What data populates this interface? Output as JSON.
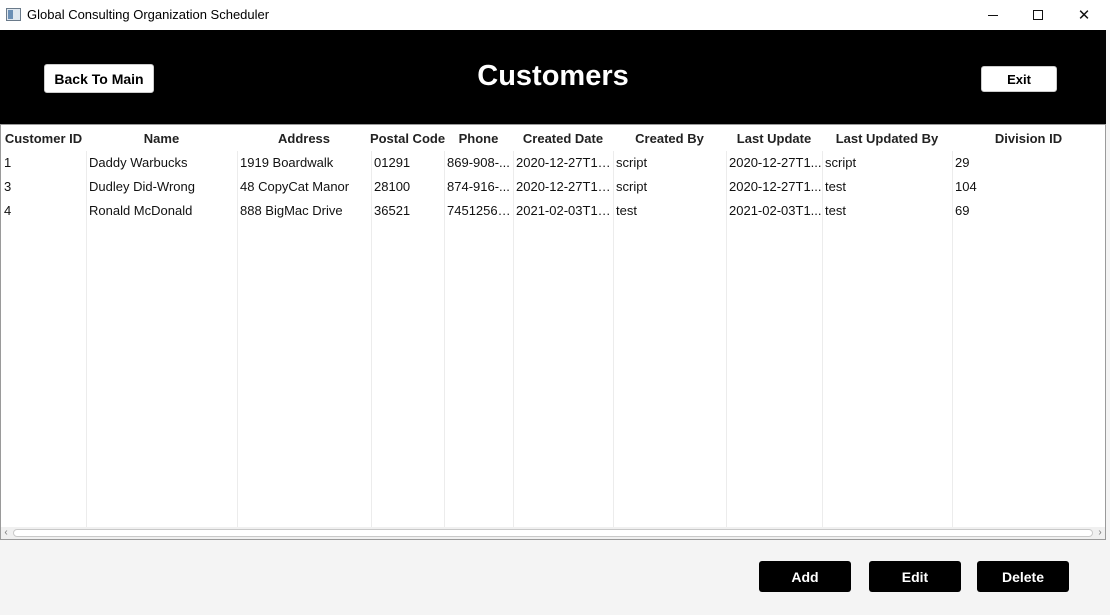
{
  "window": {
    "title": "Global Consulting Organization Scheduler",
    "icon": "app-window-icon"
  },
  "header": {
    "back_label": "Back To Main",
    "title": "Customers",
    "exit_label": "Exit"
  },
  "table": {
    "columns": [
      "Customer ID",
      "Name",
      "Address",
      "Postal Code",
      "Phone",
      "Created Date",
      "Created By",
      "Last Update",
      "Last Updated By",
      "Division ID"
    ],
    "rows": [
      [
        "1",
        "Daddy Warbucks",
        "1919 Boardwalk",
        "01291",
        "869-908-...",
        "2020-12-27T14:...",
        "script",
        "2020-12-27T1...",
        "script",
        "29"
      ],
      [
        "3",
        "Dudley Did-Wrong",
        "48 CopyCat Manor",
        "28100",
        "874-916-...",
        "2020-12-27T14:...",
        "script",
        "2020-12-27T1...",
        "test",
        "104"
      ],
      [
        "4",
        "Ronald McDonald",
        "888 BigMac Drive",
        "36521",
        "74512563...",
        "2021-02-03T18:...",
        "test",
        "2021-02-03T1...",
        "test",
        "69"
      ]
    ]
  },
  "footer": {
    "add_label": "Add",
    "edit_label": "Edit",
    "delete_label": "Delete"
  }
}
